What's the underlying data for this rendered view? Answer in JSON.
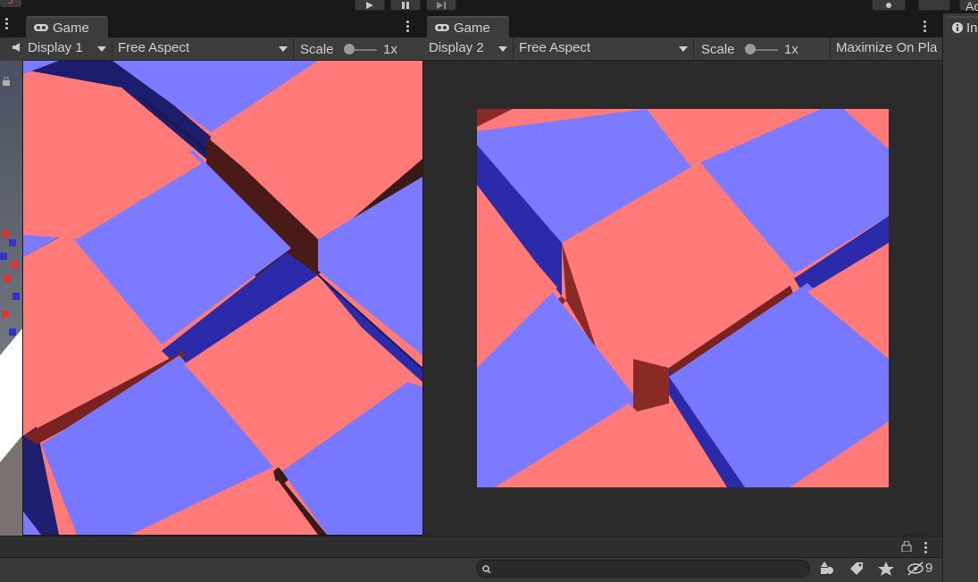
{
  "app": {
    "accent_color": "#3a3a3a"
  },
  "toolbar": {
    "play_icon": "play-icon",
    "pause_icon": "pause-icon",
    "step_icon": "step-icon",
    "right_edge_label": "Ac"
  },
  "panels": [
    {
      "tab_title": "Game",
      "display": "Display 1",
      "aspect": "Free Aspect",
      "scale_label": "Scale",
      "scale_value": "1x"
    },
    {
      "tab_title": "Game",
      "display": "Display 2",
      "aspect": "Free Aspect",
      "scale_label": "Scale",
      "scale_value": "1x",
      "maximize_label": "Maximize On Pla"
    }
  ],
  "inspector": {
    "tab_title": "In"
  },
  "bottom": {
    "search_placeholder": "",
    "hidden_count": "9"
  },
  "colors": {
    "cube_red": "#ff7a78",
    "cube_blue": "#7b7cff",
    "shadow_red": "#8a2a27",
    "shadow_blue": "#2b2aa8",
    "background_dark": "#2b2b2b"
  }
}
